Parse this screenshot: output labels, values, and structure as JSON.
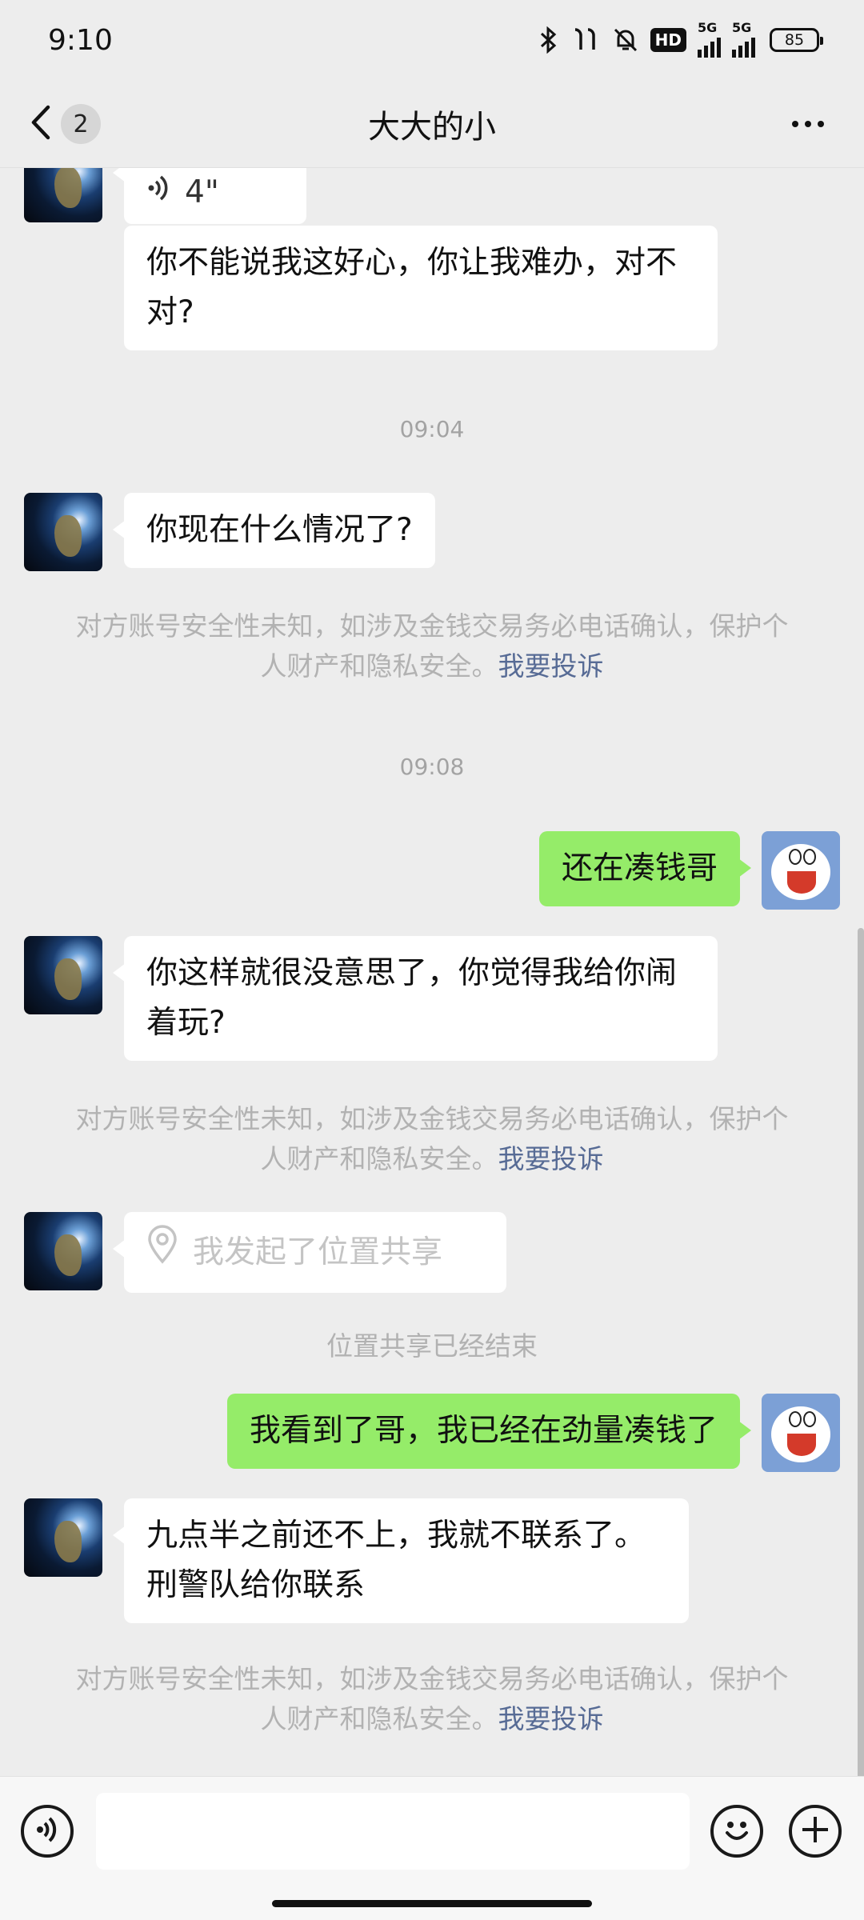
{
  "status_bar": {
    "time": "9:10",
    "hd_label": "HD",
    "network_1": "5G",
    "network_2": "5G",
    "battery": "85",
    "icons": [
      "bluetooth-icon",
      "earbuds-icon",
      "mute-bell-icon",
      "hd-badge-icon",
      "signal-5g-icon",
      "signal-5g-icon",
      "battery-icon"
    ]
  },
  "header": {
    "back_icon": "chevron-left-icon",
    "unread_count": "2",
    "title": "大大的小",
    "more_icon": "more-dots-icon"
  },
  "messages": {
    "m1_voice_duration": "4\"",
    "m2_text": "你不能说我这好心，你让我难办，对不对?",
    "ts1": "09:04",
    "m3_text": "你现在什么情况了?",
    "notice1_text": "对方账号安全性未知，如涉及金钱交易务必电话确认，保护个人财产和隐私安全。",
    "notice1_link": "我要投诉",
    "ts2": "09:08",
    "m4_text": "还在凑钱哥",
    "m5_text": "你这样就很没意思了，你觉得我给你闹着玩?",
    "notice2_text": "对方账号安全性未知，如涉及金钱交易务必电话确认，保护个人财产和隐私安全。",
    "notice2_link": "我要投诉",
    "m6_text": "我发起了位置共享",
    "system_location_ended": "位置共享已经结束",
    "m7_text": "我看到了哥，我已经在劲量凑钱了",
    "m8_text": "九点半之前还不上，我就不联系了。刑警队给你联系",
    "notice3_text": "对方账号安全性未知，如涉及金钱交易务必电话确认，保护个人财产和隐私安全。",
    "notice3_link": "我要投诉"
  },
  "input_bar": {
    "voice_icon": "voice-input-icon",
    "input_value": "",
    "emoji_icon": "emoji-icon",
    "plus_icon": "plus-icon"
  },
  "colors": {
    "background": "#ededed",
    "bubble_in": "#ffffff",
    "bubble_out": "#95ec69",
    "link": "#576b95",
    "muted_text": "#b2b2b2"
  }
}
